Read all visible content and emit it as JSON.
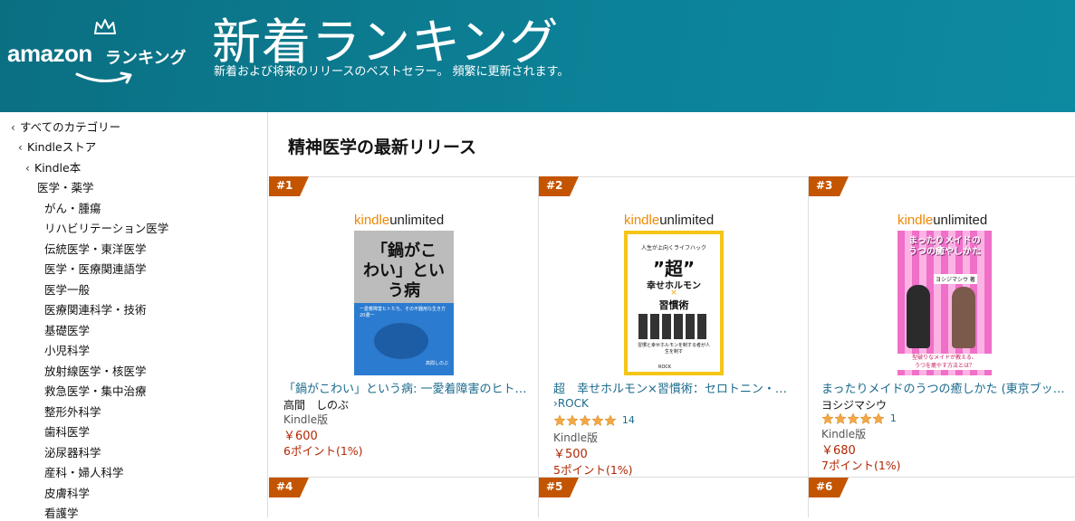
{
  "banner": {
    "logo_word": "amazon",
    "logo_suffix": "ランキング",
    "title": "新着ランキング",
    "subtitle": "新着および将来のリリースのベストセラー。 頻繁に更新されます。"
  },
  "sidebar": {
    "all_categories": "すべてのカテゴリー",
    "store": "Kindleストア",
    "books": "Kindle本",
    "current": "医学・薬学",
    "items": [
      "がん・腫瘍",
      "リハビリテーション医学",
      "伝統医学・東洋医学",
      "医学・医療関連語学",
      "医学一般",
      "医療関連科学・技術",
      "基礎医学",
      "小児科学",
      "放射線医学・核医学",
      "救急医学・集中治療",
      "整形外科学",
      "歯科医学",
      "泌尿器科学",
      "産科・婦人科学",
      "皮膚科学",
      "看護学"
    ]
  },
  "main": {
    "heading": "精神医学の最新リリース",
    "ku_label_a": "kindle",
    "ku_label_b": "unlimited",
    "products": [
      {
        "rank": "#1",
        "title": "「鍋がこわい」という病: 一愛着障害のヒト…",
        "author": "高間　しのぶ",
        "format": "Kindle版",
        "price": "￥600",
        "points": "6ポイント(1%)",
        "cover": {
          "line1": "「鍋がこ",
          "line2": "わい」とい",
          "line3": "う病",
          "band": "一愛着障害ヒトたち、その不器用な生き方20選一",
          "author_small": "高間しのぶ"
        }
      },
      {
        "rank": "#2",
        "title": "超　幸せホルモン×習慣術：セロトニン・ド…",
        "author": "ROCK",
        "format": "Kindle版",
        "price": "￥500",
        "points": "5ポイント(1%)",
        "rating": 5,
        "reviews": "14",
        "cover": {
          "top": "人生が上向くライフハック",
          "big": "”超”",
          "mid": "幸せホルモン",
          "x": "×",
          "low": "習慣術",
          "note": "習慣と幸せホルモンを制する者が人生を制す",
          "brand": "ROCK"
        }
      },
      {
        "rank": "#3",
        "title": "まったりメイドのうつの癒しかた (東京ブッ…",
        "author": "ヨシジマシウ",
        "format": "Kindle版",
        "price": "￥680",
        "points": "7ポイント(1%)",
        "rating": 5,
        "reviews": "1",
        "cover": {
          "title": "まったりメイドの",
          "title2": "うつの癒やしかた",
          "author": "ヨシジマシウ 著",
          "tag": "型破りなメイドが教える、",
          "tag2": "うつを癒やす方法とは？"
        }
      },
      {
        "rank": "#4"
      },
      {
        "rank": "#5"
      },
      {
        "rank": "#6"
      }
    ]
  },
  "colors": {
    "banner": "#0c8197",
    "rank_badge": "#c45500",
    "link": "#1a6a8c",
    "price": "#b12704",
    "star": "#f3a847"
  }
}
